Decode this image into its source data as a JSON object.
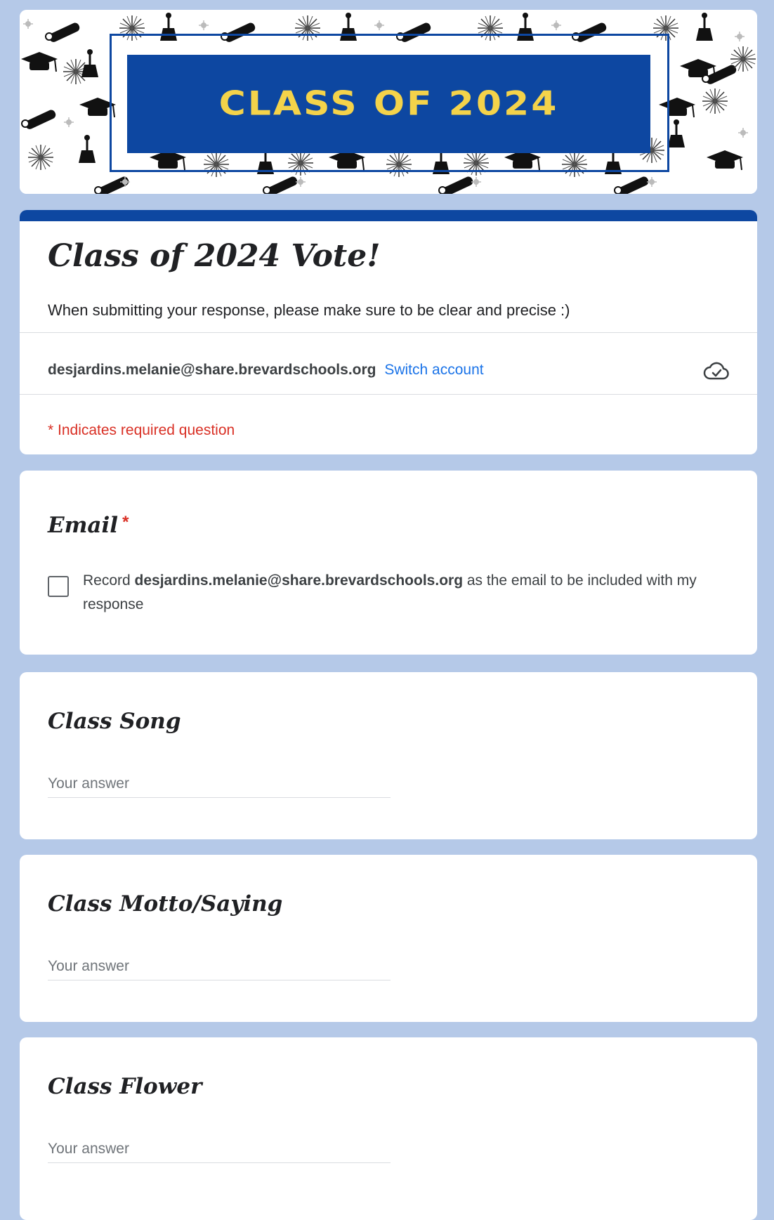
{
  "banner": {
    "title": "CLASS OF 2024"
  },
  "form": {
    "title": "Class of 2024 Vote!",
    "description": "When submitting your response, please make sure to be clear and precise :)",
    "account_email": "desjardins.melanie@share.brevardschools.org",
    "switch_account": "Switch account",
    "required_note": "* Indicates required question"
  },
  "questions": {
    "email": {
      "title": "Email",
      "required_star": "*",
      "checkbox_prefix": "Record ",
      "checkbox_email": "desjardins.melanie@share.brevardschools.org",
      "checkbox_suffix": " as the email to be included with my response"
    },
    "song": {
      "title": "Class Song",
      "placeholder": "Your answer"
    },
    "motto": {
      "title": "Class Motto/Saying",
      "placeholder": "Your answer"
    },
    "flower": {
      "title": "Class Flower",
      "placeholder": "Your answer"
    }
  },
  "colors": {
    "page_background": "#b5c9e8",
    "theme": "#0d47a1",
    "banner_text": "#f4d34a",
    "required": "#d93025",
    "link": "#1a73e8"
  },
  "icons": {
    "cloud": "cloud-check-icon",
    "checkbox": "checkbox-unchecked-icon"
  }
}
